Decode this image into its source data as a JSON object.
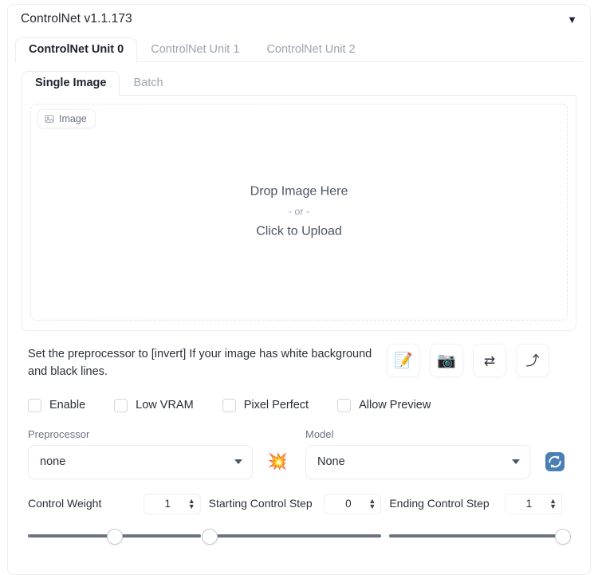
{
  "panel": {
    "title": "ControlNet v1.1.173",
    "collapse_icon": "chevron-down-filled"
  },
  "unit_tabs": [
    {
      "label": "ControlNet Unit 0",
      "active": true
    },
    {
      "label": "ControlNet Unit 1",
      "active": false
    },
    {
      "label": "ControlNet Unit 2",
      "active": false
    }
  ],
  "source_tabs": [
    {
      "label": "Single Image",
      "active": true
    },
    {
      "label": "Batch",
      "active": false
    }
  ],
  "image_area": {
    "badge_label": "Image",
    "badge_icon": "image-icon",
    "drop_title": "Drop Image Here",
    "drop_or": "- or -",
    "drop_upload": "Click to Upload"
  },
  "hint": {
    "text": "Set the preprocessor to [invert] If your image has white background and black lines."
  },
  "tool_buttons": [
    {
      "name": "open-new-canvas-button",
      "icon": "memo-icon",
      "glyph": "📝"
    },
    {
      "name": "webcam-button",
      "icon": "camera-icon",
      "glyph": "📷"
    },
    {
      "name": "mirror-webcam-button",
      "icon": "swap-arrows-icon",
      "glyph": "⇄"
    },
    {
      "name": "send-dimensions-button",
      "icon": "arrow-up-icon",
      "glyph": "⤴"
    }
  ],
  "checkboxes": [
    {
      "label": "Enable",
      "checked": false
    },
    {
      "label": "Low VRAM",
      "checked": false
    },
    {
      "label": "Pixel Perfect",
      "checked": false
    },
    {
      "label": "Allow Preview",
      "checked": false
    }
  ],
  "dropdowns": {
    "preprocessor": {
      "label": "Preprocessor",
      "value": "none"
    },
    "model": {
      "label": "Model",
      "value": "None"
    },
    "run_preprocessor_icon": "explosion-icon",
    "run_preprocessor_glyph": "💥",
    "refresh_models_icon": "refresh-icon"
  },
  "sliders": [
    {
      "name": "control-weight",
      "label": "Control Weight",
      "value": "1",
      "min": 0,
      "max": 2,
      "percent": 50
    },
    {
      "name": "starting-control-step",
      "label": "Starting Control Step",
      "value": "0",
      "min": 0,
      "max": 1,
      "percent": 0
    },
    {
      "name": "ending-control-step",
      "label": "Ending Control Step",
      "value": "1",
      "min": 0,
      "max": 1,
      "percent": 100
    }
  ],
  "colors": {
    "accent_blue": "#4a7fb5",
    "border": "#ececf1",
    "text": "#2b2f3a",
    "muted": "#9ca3af",
    "rail": "#6b7280"
  }
}
